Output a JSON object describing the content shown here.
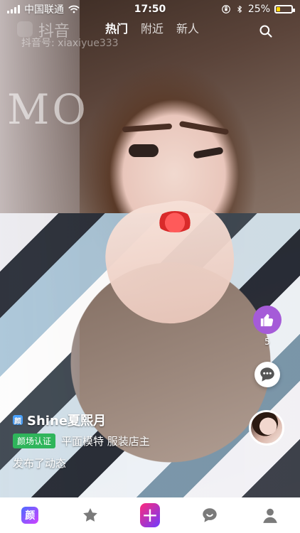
{
  "status_bar": {
    "carrier": "中国联通",
    "time": "17:50",
    "battery_percent": "25%",
    "battery_level": 0.25,
    "battery_color": "#ffd400"
  },
  "top_nav": {
    "brand_name": "抖音",
    "brand_id": "抖音号: xiaxiyue333",
    "tabs": [
      "热门",
      "附近",
      "新人"
    ],
    "active_tab": "热门"
  },
  "post": {
    "yan_badge": "颜",
    "user_name": "Shine夏熙月",
    "verified_label": "颜场认证",
    "description": "平面模特 服装店主",
    "status_text": "发布了动态",
    "likes": "5"
  },
  "bottom_nav": {
    "yan_label": "颜",
    "items": [
      "yan-home",
      "favorites",
      "add",
      "messages",
      "profile"
    ]
  },
  "colors": {
    "like": "#a55bd8",
    "verify": "#2fb55b",
    "add_gradient_start": "#ff2a7a",
    "add_gradient_end": "#6f3cff",
    "yan_gradient_start": "#4b6cff",
    "yan_gradient_end": "#d040ff"
  },
  "icons": {
    "wifi": "wifi-icon",
    "location_lock": "rotation-lock-icon",
    "bluetooth": "bluetooth-icon",
    "search": "search-icon",
    "like": "thumbs-up-icon",
    "comment": "comment-icon",
    "tab_star": "star-icon",
    "tab_message": "chat-icon",
    "tab_profile": "user-icon"
  }
}
